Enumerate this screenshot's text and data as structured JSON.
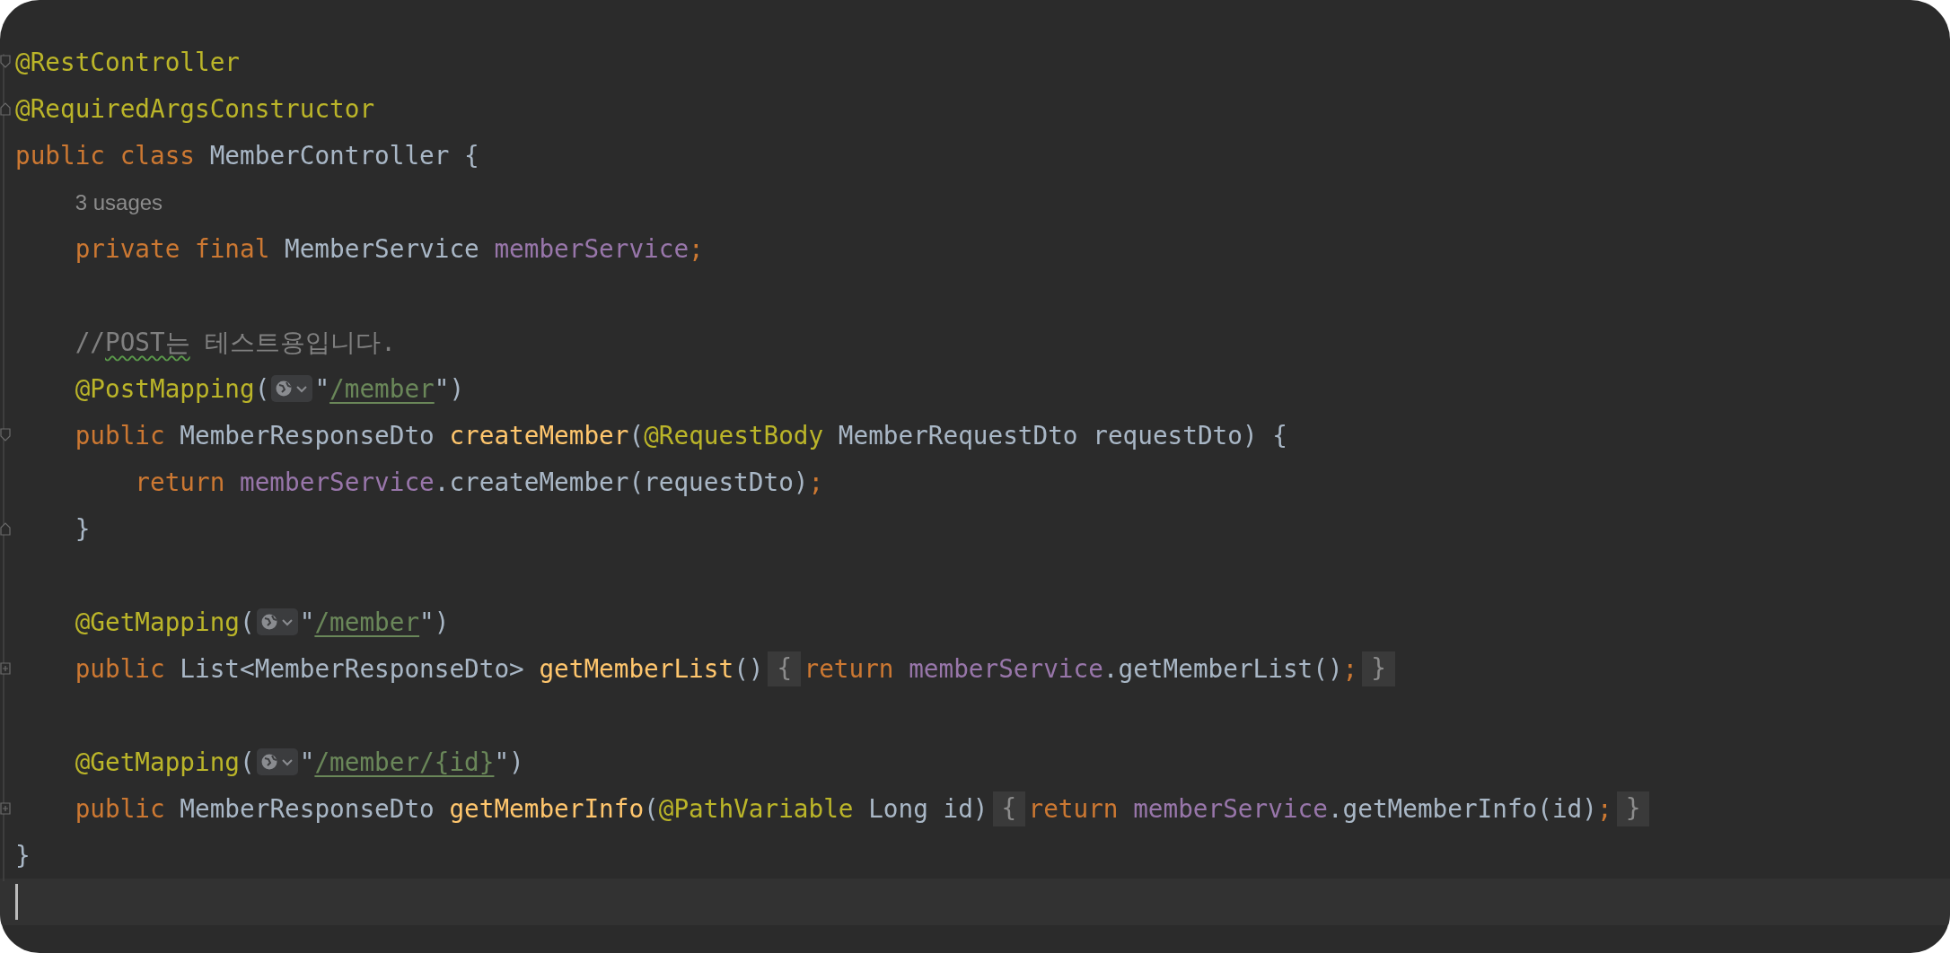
{
  "editor": {
    "lines": [
      {
        "kind": "code",
        "fold_start": true,
        "tokens": [
          {
            "kind": "annotation",
            "text": "@RestController"
          }
        ]
      },
      {
        "kind": "code",
        "fold_end": true,
        "tokens": [
          {
            "kind": "annotation",
            "text": "@RequiredArgsConstructor"
          }
        ]
      },
      {
        "kind": "code",
        "tokens": [
          {
            "kind": "keyword",
            "text": "public class"
          },
          {
            "kind": "plain",
            "text": "MemberController {",
            "spaced": true
          }
        ],
        "children": [
          {
            "kind": "hint",
            "tokens": [
              {
                "kind": "hint",
                "text": "3 usages"
              }
            ]
          },
          {
            "kind": "code",
            "tokens": [
              {
                "kind": "keyword",
                "text": "private final"
              },
              {
                "kind": "plain",
                "text": "MemberService",
                "spaced": true
              },
              {
                "kind": "field",
                "text": "memberService",
                "spaced": true
              },
              {
                "kind": "keyword",
                "text": ";"
              }
            ]
          },
          {
            "kind": "blank"
          },
          {
            "kind": "code",
            "tokens": [
              {
                "kind": "comment",
                "text": "//"
              },
              {
                "kind": "typo",
                "text": "POST는"
              },
              {
                "kind": "comment",
                "text": "테스트용입니다.",
                "spaced": true
              }
            ]
          },
          {
            "kind": "code",
            "tokens": [
              {
                "kind": "annotation",
                "text": "@PostMapping"
              },
              {
                "kind": "plain",
                "text": "("
              },
              {
                "kind": "url-icon"
              },
              {
                "kind": "plain",
                "text": "\""
              },
              {
                "kind": "url",
                "text": "/member"
              },
              {
                "kind": "plain",
                "text": "\")"
              }
            ]
          },
          {
            "kind": "code",
            "fold_start": true,
            "tokens": [
              {
                "kind": "keyword",
                "text": "public"
              },
              {
                "kind": "plain",
                "text": "MemberResponseDto",
                "spaced": true
              },
              {
                "kind": "method",
                "text": "createMember",
                "spaced": true
              },
              {
                "kind": "plain",
                "text": "("
              },
              {
                "kind": "annotation",
                "text": "@RequestBody"
              },
              {
                "kind": "plain",
                "text": "MemberRequestDto requestDto) {",
                "spaced": true
              }
            ],
            "children": [
              {
                "kind": "code",
                "tokens": [
                  {
                    "kind": "keyword",
                    "text": "return"
                  },
                  {
                    "kind": "field",
                    "text": "memberService",
                    "spaced": true
                  },
                  {
                    "kind": "plain",
                    "text": ".createMember(requestDto)"
                  },
                  {
                    "kind": "keyword",
                    "text": ";"
                  }
                ]
              }
            ]
          },
          {
            "kind": "code",
            "fold_end": true,
            "tokens": [
              {
                "kind": "plain",
                "text": "}"
              }
            ]
          },
          {
            "kind": "blank"
          },
          {
            "kind": "code",
            "tokens": [
              {
                "kind": "annotation",
                "text": "@GetMapping"
              },
              {
                "kind": "plain",
                "text": "("
              },
              {
                "kind": "url-icon"
              },
              {
                "kind": "plain",
                "text": "\""
              },
              {
                "kind": "url",
                "text": "/member"
              },
              {
                "kind": "plain",
                "text": "\")"
              }
            ]
          },
          {
            "kind": "code",
            "collapsed": true,
            "tokens": [
              {
                "kind": "keyword",
                "text": "public"
              },
              {
                "kind": "plain",
                "text": "List<MemberResponseDto>",
                "spaced": true
              },
              {
                "kind": "method",
                "text": "getMemberList",
                "spaced": true
              },
              {
                "kind": "plain",
                "text": "()"
              },
              {
                "kind": "folded",
                "text": "{"
              },
              {
                "kind": "keyword",
                "text": "return"
              },
              {
                "kind": "field",
                "text": "memberService",
                "spaced": true
              },
              {
                "kind": "plain",
                "text": ".getMemberList()"
              },
              {
                "kind": "keyword",
                "text": ";"
              },
              {
                "kind": "folded",
                "text": "}"
              }
            ]
          },
          {
            "kind": "blank"
          },
          {
            "kind": "code",
            "tokens": [
              {
                "kind": "annotation",
                "text": "@GetMapping"
              },
              {
                "kind": "plain",
                "text": "("
              },
              {
                "kind": "url-icon"
              },
              {
                "kind": "plain",
                "text": "\""
              },
              {
                "kind": "url",
                "text": "/member/{id}"
              },
              {
                "kind": "plain",
                "text": "\")"
              }
            ]
          },
          {
            "kind": "code",
            "collapsed": true,
            "tokens": [
              {
                "kind": "keyword",
                "text": "public"
              },
              {
                "kind": "plain",
                "text": "MemberResponseDto",
                "spaced": true
              },
              {
                "kind": "method",
                "text": "getMemberInfo",
                "spaced": true
              },
              {
                "kind": "plain",
                "text": "("
              },
              {
                "kind": "annotation",
                "text": "@PathVariable"
              },
              {
                "kind": "plain",
                "text": "Long id)",
                "spaced": true
              },
              {
                "kind": "folded",
                "text": "{"
              },
              {
                "kind": "keyword",
                "text": "return"
              },
              {
                "kind": "field",
                "text": "memberService",
                "spaced": true
              },
              {
                "kind": "plain",
                "text": ".getMemberInfo(id)"
              },
              {
                "kind": "keyword",
                "text": ";"
              },
              {
                "kind": "folded",
                "text": "}"
              }
            ]
          }
        ]
      },
      {
        "kind": "code",
        "tokens": [
          {
            "kind": "plain",
            "text": "}"
          }
        ]
      },
      {
        "kind": "cursor"
      }
    ]
  }
}
